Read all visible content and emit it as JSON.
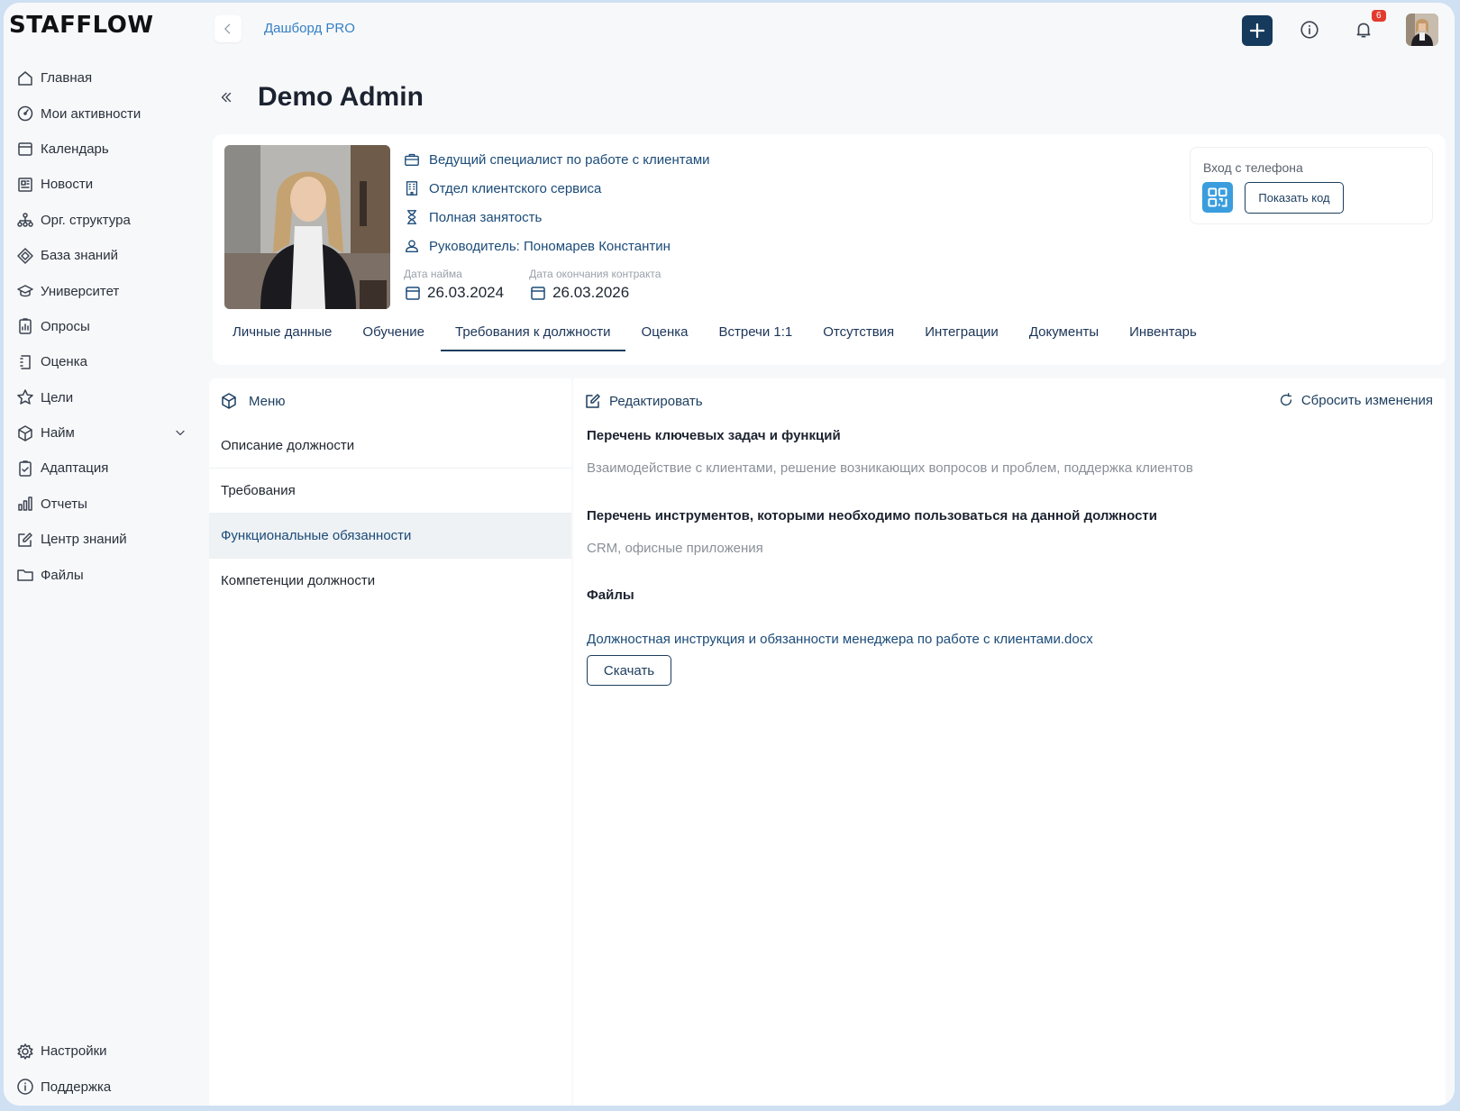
{
  "app": {
    "logo": "STAFFLOW"
  },
  "sidebar": {
    "items": [
      {
        "label": "Главная",
        "icon": "home-icon"
      },
      {
        "label": "Мои активности",
        "icon": "gauge-icon"
      },
      {
        "label": "Календарь",
        "icon": "calendar-icon"
      },
      {
        "label": "Новости",
        "icon": "newspaper-icon"
      },
      {
        "label": "Орг. структура",
        "icon": "org-structure-icon"
      },
      {
        "label": "База знаний",
        "icon": "diamond-icon"
      },
      {
        "label": "Университет",
        "icon": "graduation-cap-icon"
      },
      {
        "label": "Опросы",
        "icon": "clipboard-chart-icon"
      },
      {
        "label": "Оценка",
        "icon": "rating-icon"
      },
      {
        "label": "Цели",
        "icon": "star-icon"
      },
      {
        "label": "Найм",
        "icon": "cube-icon"
      },
      {
        "label": "Адаптация",
        "icon": "clipboard-check-icon"
      },
      {
        "label": "Отчеты",
        "icon": "bar-chart-icon"
      },
      {
        "label": "Центр знаний",
        "icon": "edit-square-icon"
      },
      {
        "label": "Файлы",
        "icon": "folder-icon"
      }
    ],
    "bottom": [
      {
        "label": "Настройки",
        "icon": "gear-icon"
      },
      {
        "label": "Поддержка",
        "icon": "info-icon"
      }
    ]
  },
  "topbar": {
    "breadcrumb": "Дашборд PRO",
    "notifications_count": "6"
  },
  "page": {
    "title": "Demo Admin"
  },
  "profile": {
    "position": "Ведущий специалист по работе с клиентами",
    "department": "Отдел клиентского сервиса",
    "employment": "Полная занятость",
    "manager": "Руководитель: Пономарев Константин",
    "hire_label": "Дата найма",
    "hire_date": "26.03.2024",
    "contract_end_label": "Дата окончания контракта",
    "contract_end_date": "26.03.2026",
    "phone_login_title": "Вход с телефона",
    "show_code_label": "Показать код"
  },
  "tabs": [
    {
      "label": "Личные данные"
    },
    {
      "label": "Обучение"
    },
    {
      "label": "Требования к должности",
      "active": true
    },
    {
      "label": "Оценка"
    },
    {
      "label": "Встречи 1:1"
    },
    {
      "label": "Отсутствия"
    },
    {
      "label": "Интеграции"
    },
    {
      "label": "Документы"
    },
    {
      "label": "Инвентарь"
    }
  ],
  "menu": {
    "title": "Меню",
    "items": [
      {
        "label": "Описание должности"
      },
      {
        "label": "Требования"
      },
      {
        "label": "Функциональные обязанности",
        "active": true
      },
      {
        "label": "Компетенции должности"
      }
    ]
  },
  "content": {
    "edit_label": "Редактировать",
    "reset_label": "Сбросить изменения",
    "tasks_title": "Перечень ключевых задач и функций",
    "tasks_text": "Взаимодействие с клиентами, решение возникающих вопросов и проблем, поддержка клиентов",
    "tools_title": "Перечень инструментов, которыми необходимо пользоваться на данной должности",
    "tools_text": "CRM, офисные приложения",
    "files_title": "Файлы",
    "file_name": "Должностная инструкция и обязанности менеджера по работе с клиентами.docx",
    "download_label": "Скачать"
  },
  "colors": {
    "accent": "#153a5c",
    "link": "#1b4b78",
    "breadcrumb": "#3580c4",
    "qr": "#3a9ddd",
    "badge": "#e23b2e"
  }
}
